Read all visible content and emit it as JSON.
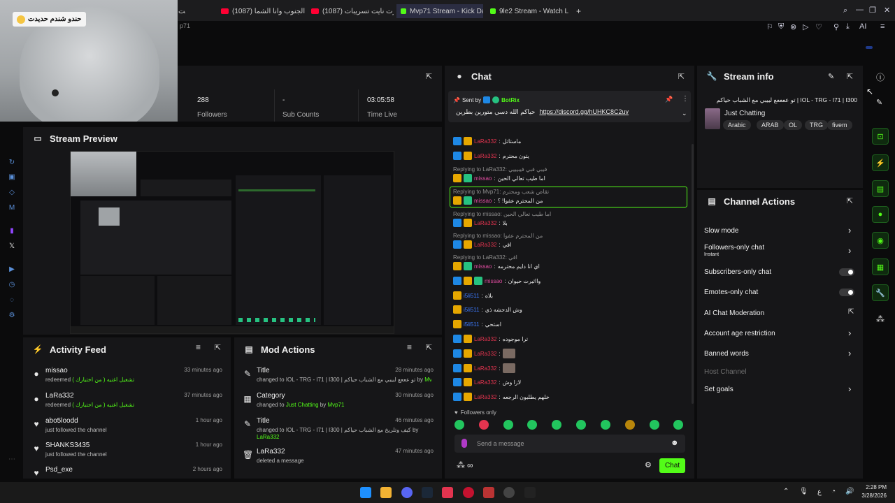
{
  "browser": {
    "tabs": [
      {
        "label": "(1087) انتي الجنوب وانا الشما...",
        "color": "#ff0033"
      },
      {
        "label": "(1087) فورت نايت تسريبات .. ...",
        "color": "#ff0033"
      },
      {
        "label": "Mvp71 Stream - Kick Dash",
        "color": "#53fc18"
      },
      {
        "label": "9le2 Stream - Watch Live",
        "color": "#53fc18"
      }
    ],
    "new_tab": "+",
    "extensions_label": "AI",
    "left_tab_fragment": "مت",
    "url_fragment": "p71"
  },
  "webcam": {
    "caption": "حندو شندم حديدت"
  },
  "stats": [
    {
      "value": "288",
      "label": "Followers"
    },
    {
      "value": "-",
      "label": "Sub Counts"
    },
    {
      "value": "03:05:58",
      "label": "Time Live"
    }
  ],
  "stream_preview": {
    "title": "Stream Preview"
  },
  "activity_feed": {
    "title": "Activity Feed",
    "items": [
      {
        "icon": "user-icon",
        "name": "missao",
        "desc": "redeemed",
        "desc_extra": "تشغيل اغنيه ( من اختيارك )",
        "time": "33 minutes ago"
      },
      {
        "icon": "user-icon",
        "name": "LaRa332",
        "desc": "redeemed",
        "desc_extra": "تشغيل اغنيه ( من اختيارك )",
        "time": "37 minutes ago"
      },
      {
        "icon": "heart-icon",
        "name": "abo5loodd",
        "desc": "just followed the channel",
        "desc_extra": "",
        "time": "1 hour ago"
      },
      {
        "icon": "heart-icon",
        "name": "SHANKS3435",
        "desc": "just followed the channel",
        "desc_extra": "",
        "time": "1 hour ago"
      },
      {
        "icon": "heart-icon",
        "name": "Psd_exe",
        "desc": "",
        "desc_extra": "",
        "time": "2 hours ago"
      }
    ]
  },
  "mod_actions": {
    "title": "Mod Actions",
    "items": [
      {
        "title": "Title",
        "desc": "changed to IOL - TRG - I71 | I300 | تو عععع لبيبي مع الشباب حياكم",
        "by": "Mvp71",
        "time": "28 minutes ago"
      },
      {
        "title": "Category",
        "desc": "changed to",
        "desc_link": "Just Chatting",
        "by": "Mvp71",
        "time": "30 minutes ago"
      },
      {
        "title": "Title",
        "desc": "changed to IOL - TRG - I71 | I300 | كيف وتلريخ مع الشباب حياكم",
        "by": "LaRa332",
        "time": "46 minutes ago"
      },
      {
        "title": "LaRa332",
        "desc": "deleted a message",
        "by": "",
        "time": "47 minutes ago"
      }
    ],
    "by_label": "by"
  },
  "chat": {
    "title": "Chat",
    "pinned": {
      "sent_by_label": "Sent by",
      "sender": "BotRix",
      "text": "حياكم الله دسي متورين بطرين",
      "link": "https://discord.gg/hUHKC8C2uv"
    },
    "messages": [
      {
        "kind": "msg",
        "user": "LaRa332",
        "color": "red",
        "text": "ماستاتل"
      },
      {
        "kind": "msg",
        "user": "LaRa332",
        "color": "red",
        "text": "يتون محترم"
      },
      {
        "kind": "reply",
        "text": "Replying to LaRa332: فيبي فبي فيبيييي"
      },
      {
        "kind": "msg",
        "user": "missao",
        "color": "pink",
        "text": "اما طيب تعالي الحين"
      },
      {
        "kind": "reply",
        "text": "Replying to Mvp71: تقاص شعب ومحترم"
      },
      {
        "kind": "msg",
        "user": "missao",
        "color": "pink",
        "text": "من المحترم عفوا! ؟"
      },
      {
        "kind": "reply",
        "text": "Replying to missao: اما طيب تعالي الحين"
      },
      {
        "kind": "msg",
        "user": "LaRa332",
        "color": "red",
        "text": "بلا"
      },
      {
        "kind": "reply",
        "text": "Replying to missao: من المحترم عفوا"
      },
      {
        "kind": "msg",
        "user": "LaRa332",
        "color": "red",
        "text": "اقي"
      },
      {
        "kind": "reply",
        "text": "Replying to LaRa332: اقي"
      },
      {
        "kind": "msg",
        "user": "missao",
        "color": "pink",
        "text": "اي انا دايم محترمه"
      },
      {
        "kind": "msg",
        "user": "missao",
        "color": "pink",
        "text": "وااثيرت حيوان"
      },
      {
        "kind": "msg",
        "user": "i5li511",
        "color": "blue",
        "text": "بلاه"
      },
      {
        "kind": "msg",
        "user": "i5li511",
        "color": "blue",
        "text": "وش الدحشه ذي"
      },
      {
        "kind": "msg",
        "user": "i5li511",
        "color": "blue",
        "text": "استحي"
      },
      {
        "kind": "msg",
        "user": "LaRa332",
        "color": "red",
        "text": "ترا موجوده"
      },
      {
        "kind": "msg",
        "user": "LaRa332",
        "color": "red",
        "text": ""
      },
      {
        "kind": "msg",
        "user": "LaRa332",
        "color": "red",
        "text": ""
      },
      {
        "kind": "msg",
        "user": "LaRa332",
        "color": "red",
        "text": "لازا وش"
      },
      {
        "kind": "msg",
        "user": "LaRa332",
        "color": "red",
        "text": "خلهم يطلبون الرجعه"
      }
    ],
    "followers_only": "Followers only",
    "input_placeholder": "Send a message",
    "send_label": "Chat"
  },
  "stream_info": {
    "title": "Stream info",
    "stream_title": "IOL - TRG - I71 | I300 | تو ععععع لبيبي مع الشباب حياكم",
    "category": "Just Chatting",
    "tags": [
      "Arabic",
      "ARAB",
      "OL",
      "TRG",
      "fivem"
    ]
  },
  "channel_actions": {
    "title": "Channel Actions",
    "items": [
      {
        "label": "Slow mode",
        "type": "chevron"
      },
      {
        "label": "Followers-only chat",
        "sub": "Instant",
        "type": "chevron"
      },
      {
        "label": "Subscribers-only chat",
        "type": "toggle"
      },
      {
        "label": "Emotes-only chat",
        "type": "toggle"
      },
      {
        "label": "AI Chat Moderation",
        "type": "external"
      },
      {
        "label": "Account age restriction",
        "type": "chevron"
      },
      {
        "label": "Banned words",
        "type": "chevron"
      },
      {
        "label": "Host Channel",
        "type": "disabled"
      },
      {
        "label": "Set goals",
        "type": "chevron"
      }
    ]
  },
  "taskbar": {
    "time": "2:28 PM",
    "date": "3/28/2026",
    "lang": "ع"
  },
  "colors": {
    "accent": "#53fc18",
    "panel": "#161618",
    "background": "#0b0b0c"
  }
}
